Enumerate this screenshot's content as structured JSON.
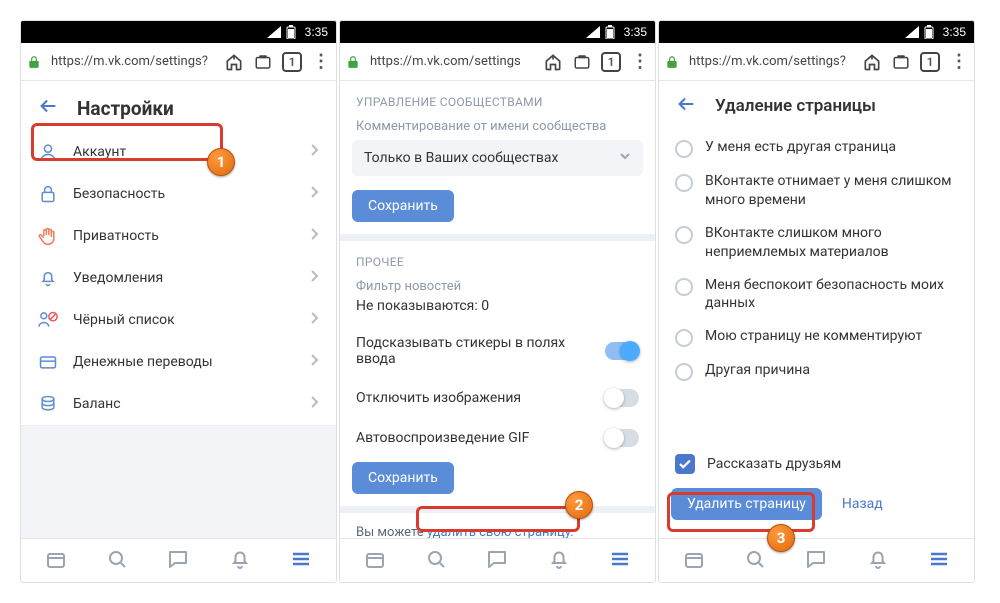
{
  "statusbar": {
    "time": "3:35"
  },
  "urlbar": {
    "url1": "https://m.vk.com/settings?",
    "url2": "https://m.vk.com/settings",
    "url3": "https://m.vk.com/settings?",
    "tabcount": "1",
    "dots": "⋮"
  },
  "phone1": {
    "title": "Настройки",
    "items": [
      {
        "label": "Аккаунт",
        "icon": "user"
      },
      {
        "label": "Безопасность",
        "icon": "lock"
      },
      {
        "label": "Приватность",
        "icon": "hand"
      },
      {
        "label": "Уведомления",
        "icon": "bell"
      },
      {
        "label": "Чёрный список",
        "icon": "users-x"
      },
      {
        "label": "Денежные переводы",
        "icon": "card"
      },
      {
        "label": "Баланс",
        "icon": "coins"
      }
    ]
  },
  "phone2": {
    "sect_comm_title": "УПРАВЛЕНИЕ СООБЩЕСТВАМИ",
    "commenting_label": "Комментирование от имени сообщества",
    "commenting_value": "Только в Ваших сообществах",
    "save": "Сохранить",
    "sect_other_title": "ПРОЧЕЕ",
    "news_filter_label": "Фильтр новостей",
    "news_filter_value": "Не показываются: 0",
    "toggle_stickers": "Подсказывать стикеры в полях ввода",
    "toggle_images": "Отключить изображения",
    "toggle_gif": "Автовоспроизведение GIF",
    "delete_prefix": "Вы можете ",
    "delete_link": "удалить свою страницу."
  },
  "phone3": {
    "title": "Удаление страницы",
    "reasons": [
      "У меня есть другая страница",
      "ВКонтакте отнимает у меня слишком много времени",
      "ВКонтакте слишком много неприемлемых материалов",
      "Меня беспокоит безопасность моих данных",
      "Мою страницу не комментируют",
      "Другая причина"
    ],
    "tell_friends": "Рассказать друзьям",
    "delete_btn": "Удалить страницу",
    "back_link": "Назад"
  },
  "annotations": {
    "b1": "1",
    "b2": "2",
    "b3": "3"
  }
}
